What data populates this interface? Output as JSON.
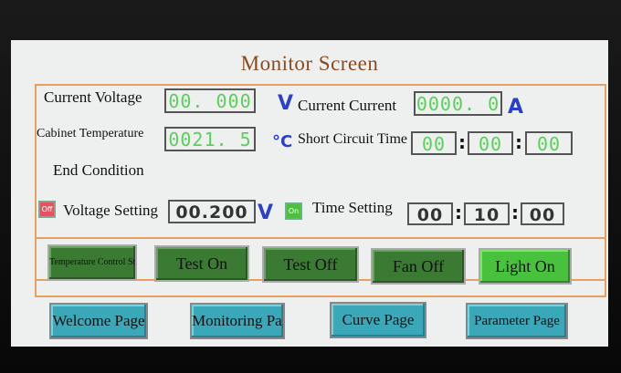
{
  "screen": {
    "title": "Monitor  Screen"
  },
  "readings": {
    "current_voltage_label": "Current Voltage",
    "current_voltage_value": "00. 000",
    "current_voltage_unit": "V",
    "current_current_label": "Current Current",
    "current_current_value": "0000. 0",
    "current_current_unit": "A",
    "cabinet_temp_label": "Cabinet Temperature",
    "cabinet_temp_value": "0021. 5",
    "cabinet_temp_unit": "°C",
    "short_circuit_label": "Short Circuit Time",
    "short_circuit_h": "00",
    "short_circuit_m": "00",
    "short_circuit_s": "00"
  },
  "end_condition": {
    "title": "End Condition",
    "voltage_indicator": "Off",
    "voltage_label": "Voltage Setting",
    "voltage_value": "00.200",
    "voltage_unit": "V",
    "time_indicator": "On",
    "time_label": "Time Setting",
    "time_h": "00",
    "time_m": "10",
    "time_s": "00"
  },
  "controls": {
    "temp_control": "Temperature Control Start",
    "test_on": "Test On",
    "test_off": "Test Off",
    "fan_off": "Fan Off",
    "light_on": "Light On"
  },
  "nav": {
    "welcome": "Welcome Page",
    "monitoring": "Monitoring Page",
    "curve": "Curve Page",
    "parameter": "Parameter Page"
  },
  "colors": {
    "value_green": "#5ad05a",
    "unit_blue": "#2a3fcc",
    "button_green": "#3a7a32",
    "nav_teal": "#3aa8b8",
    "frame_orange": "#e8a060"
  }
}
